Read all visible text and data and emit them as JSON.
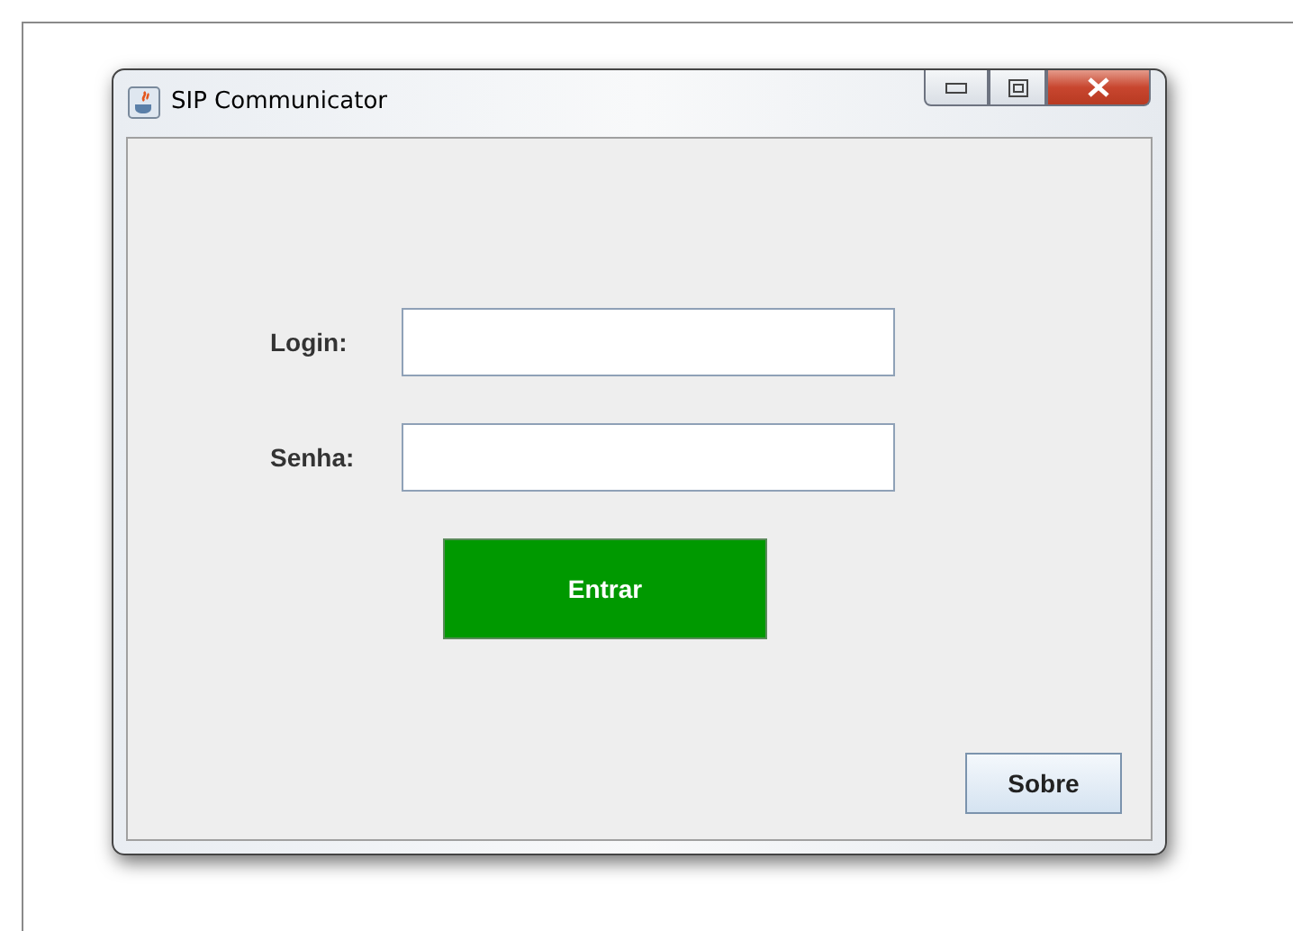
{
  "window": {
    "title": "SIP Communicator"
  },
  "fields": [
    {
      "label": "Login:"
    },
    {
      "label": "Senha:"
    }
  ],
  "login_button": "Entrar",
  "about_button": "Sobre"
}
